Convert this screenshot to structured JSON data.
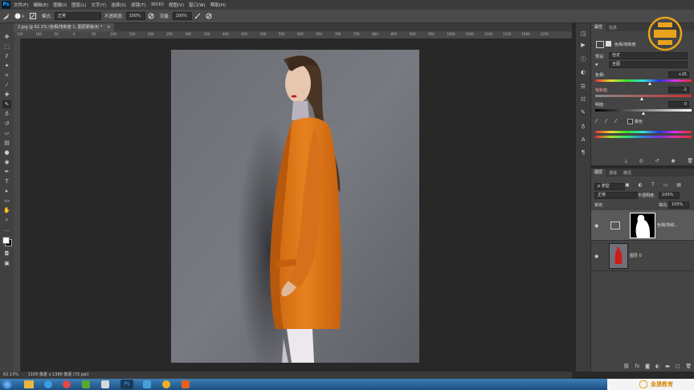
{
  "app": {
    "logo": "Ps"
  },
  "menu": [
    "文件(F)",
    "编辑(E)",
    "图像(I)",
    "图层(L)",
    "文字(Y)",
    "选择(S)",
    "滤镜(T)",
    "3D(D)",
    "视图(V)",
    "窗口(W)",
    "帮助(H)"
  ],
  "options": {
    "brush_size": "9",
    "mode_label": "模式:",
    "mode_value": "正常",
    "opacity_label": "不透明度:",
    "opacity_value": "100%",
    "flow_label": "流量:",
    "flow_value": "100%"
  },
  "document": {
    "tab_title": "2.jpg @ 62.1% (色相/饱和度 1, 图层蒙版/8) *",
    "ruler_ticks": [
      "150",
      "100",
      "50",
      "0",
      "50",
      "100",
      "150",
      "200",
      "250",
      "300",
      "350",
      "400",
      "450",
      "500",
      "550",
      "600",
      "650",
      "700",
      "750",
      "800",
      "850",
      "900",
      "950",
      "1000",
      "1050",
      "1100",
      "1150",
      "1200",
      "1250"
    ]
  },
  "status": {
    "zoom": "62.13%",
    "doc_info": "1100 像素 x 1390 像素 (72 ppi)"
  },
  "properties": {
    "tabs": [
      "属性",
      "信息"
    ],
    "adjust_title": "色相/饱和度",
    "preset_label": "预设:",
    "preset_value": "自定",
    "channel_value": "全图",
    "hue_label": "色相:",
    "hue_value": "+25",
    "saturation_label": "饱和度:",
    "saturation_value": "-2",
    "lightness_label": "明度:",
    "lightness_value": "0",
    "colorize_label": "着色",
    "hue_level": 0.57,
    "saturation_level": 0.49,
    "lightness_level": 0.5
  },
  "layers": {
    "tabs": [
      "图层",
      "通道",
      "路径"
    ],
    "filter_value": "类型",
    "blend_value": "正常",
    "opacity_label": "不透明度:",
    "opacity_value": "100%",
    "lock_label": "锁定:",
    "fill_label": "填充:",
    "fill_value": "100%",
    "items": [
      {
        "name": "色相/饱和..."
      },
      {
        "name": "图层 0"
      }
    ]
  },
  "watermark": {
    "text": "金晟教育"
  },
  "colors": {
    "coat": "#e0791a",
    "accent": "#31a8ff",
    "watermark": "#e8a31c"
  }
}
